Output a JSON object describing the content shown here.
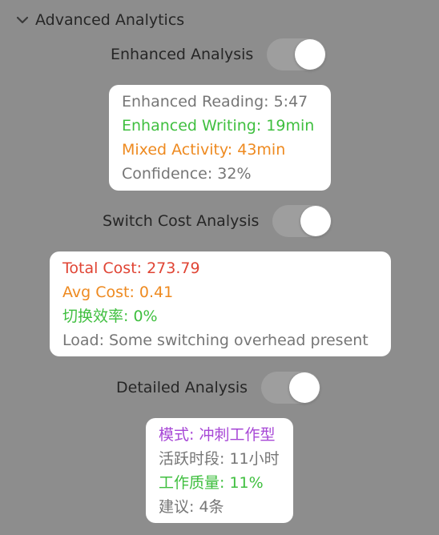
{
  "section": {
    "title": "Advanced Analytics",
    "chevron_icon": "chevron-down-icon"
  },
  "enhanced_analysis": {
    "label": "Enhanced Analysis",
    "enabled": true,
    "card": {
      "reading": "Enhanced Reading: 5:47",
      "writing": "Enhanced Writing: 19min",
      "mixed": "Mixed Activity: 43min",
      "confidence": "Confidence: 32%"
    }
  },
  "switch_cost": {
    "label": "Switch Cost Analysis",
    "enabled": true,
    "card": {
      "total_cost": "Total Cost: 273.79",
      "avg_cost": "Avg Cost: 0.41",
      "efficiency": "切换效率: 0%",
      "load": "Load: Some switching overhead present"
    }
  },
  "detailed_analysis": {
    "label": "Detailed Analysis",
    "enabled": true,
    "card": {
      "mode": "模式: 冲刺工作型",
      "active_period": "活跃时段: 11小时",
      "quality": "工作质量: 11%",
      "suggestions": "建议: 4条"
    }
  },
  "colors": {
    "background": "#8d8d8d",
    "gray_text": "#767676",
    "green": "#3fbf3f",
    "orange": "#ee8a20",
    "red": "#e04434",
    "purple": "#a747d6",
    "link_blue": "#2c66c9"
  }
}
